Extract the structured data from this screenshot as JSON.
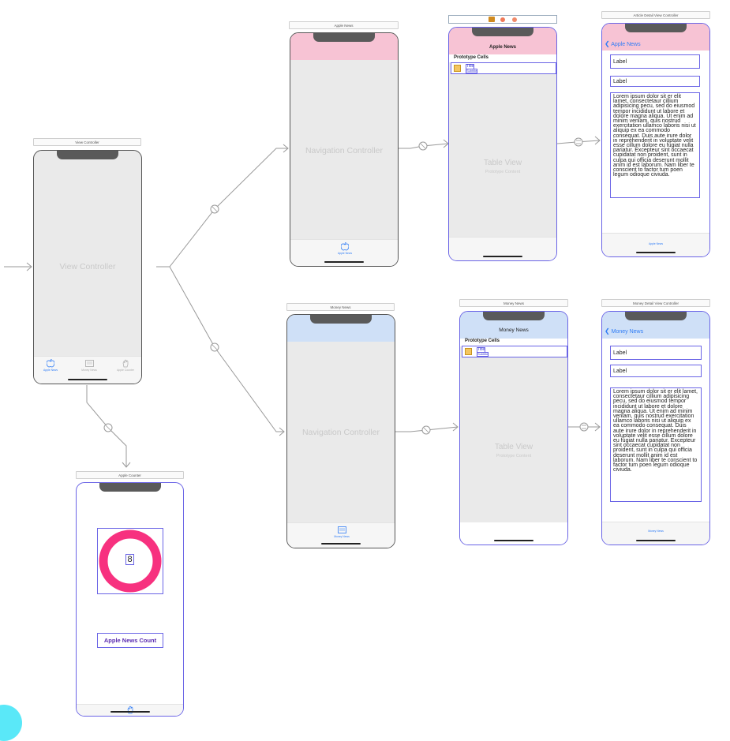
{
  "scenes": {
    "view_controller": {
      "title": "View Controller",
      "center_text": "View Controller",
      "tabs": [
        "Apple News",
        "Money News",
        "Apple Counter"
      ]
    },
    "apple_nav": {
      "title": "Apple News",
      "center_text": "Navigation Controller",
      "tab_label": "Apple News",
      "color": "#f7c3d4"
    },
    "money_nav": {
      "title": "Money News",
      "center_text": "Navigation Controller",
      "tab_label": "Money News",
      "color": "#cfe0f7"
    },
    "apple_table": {
      "nav_title": "Apple News",
      "section": "Prototype Cells",
      "cell_title": "Title",
      "cell_subtitle": "Subtitle",
      "table_text": "Table View",
      "table_subtext": "Prototype Content"
    },
    "money_table": {
      "title": "Money News",
      "nav_title": "Money News",
      "section": "Prototype Cells",
      "cell_title": "Title",
      "cell_subtitle": "Subtitle",
      "table_text": "Table View",
      "table_subtext": "Prototype Content"
    },
    "article_detail": {
      "title": "Article Detail View Controller",
      "back": "Apple News",
      "label1": "Label",
      "label2": "Label",
      "body": "Lorem ipsum dolor sit er elit lamet, consectetaur cillium adipisicing pecu, sed do eiusmod tempor incididunt ut labore et dolore magna aliqua. Ut enim ad minim veniam, quis nostrud exercitation ullamco laboris nisi ut aliquip ex ea commodo consequat. Duis aute irure dolor in reprehenderit in voluptate velit esse cillum dolore eu fugiat nulla pariatur. Excepteur sint occaecat cupidatat non proident, sunt in culpa qui officia deserunt mollit anim id est laborum. Nam liber te conscient to factor tum poen legum odioque civiuda.",
      "tab_label": "Apple News"
    },
    "money_detail": {
      "title": "Money Detail View Controller",
      "back": "Money News",
      "label1": "Label",
      "label2": "Label",
      "body": "Lorem ipsum dolor sit er elit lamet, consectetaur cillium adipisicing pecu, sed do eiusmod tempor incididunt ut labore et dolore magna aliqua. Ut enim ad minim veniam, quis nostrud exercitation ullamco laboris nisi ut aliquip ex ea commodo consequat. Duis aute irure dolor in reprehenderit in voluptate velit esse cillum dolore eu fugiat nulla pariatur. Excepteur sint occaecat cupidatat non proident, sunt in culpa qui officia deserunt mollit anim id est laborum. Nam liber te conscient to factor tum poen legum odioque civiuda.",
      "tab_label": "Money News"
    },
    "apple_counter": {
      "title": "Apple Counter",
      "count": "8",
      "button": "Apple News Count",
      "ring_color": "#f7317f"
    }
  }
}
